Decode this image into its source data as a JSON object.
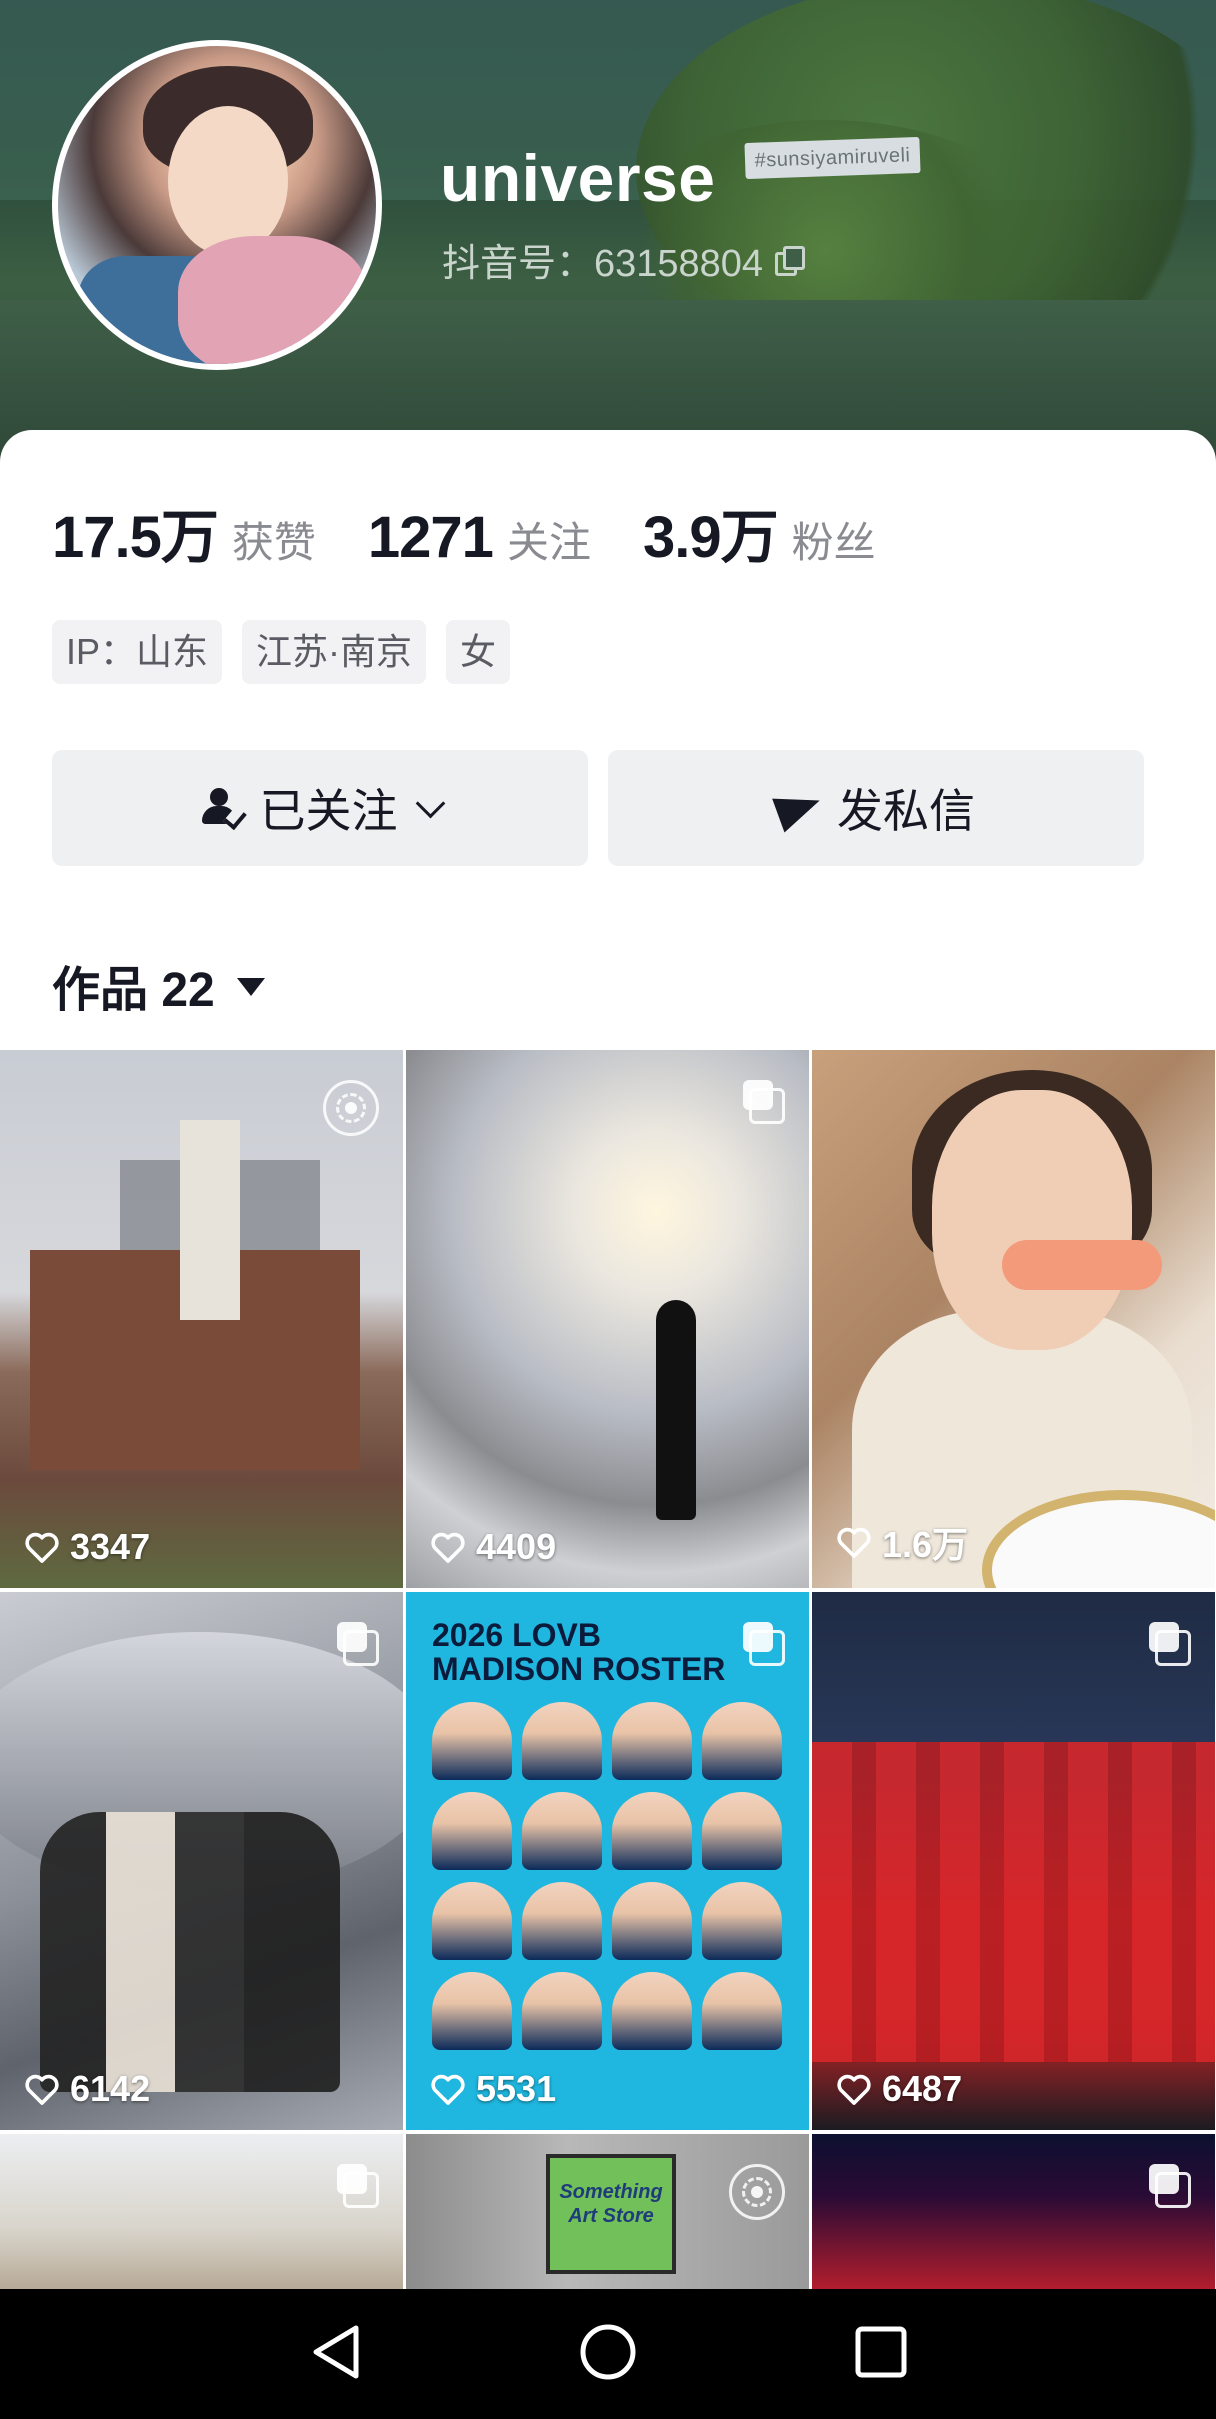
{
  "profile": {
    "username": "universe",
    "douyin_id": "抖音号：63158804",
    "cover_sign": "#sunsiyamiruveli"
  },
  "stats": [
    {
      "num": "17.5万",
      "label": "获赞"
    },
    {
      "num": "1271",
      "label": "关注"
    },
    {
      "num": "3.9万",
      "label": "粉丝"
    }
  ],
  "tags": [
    "IP：山东",
    "江苏·南京",
    "女"
  ],
  "buttons": {
    "follow": "已关注",
    "message": "发私信"
  },
  "works": {
    "label": "作品 22"
  },
  "tiles": [
    {
      "likes": "3347",
      "corner": "live-icon"
    },
    {
      "likes": "4409",
      "corner": "multi-icon"
    },
    {
      "likes": "1.6万",
      "corner": ""
    },
    {
      "likes": "6142",
      "corner": "multi-icon"
    },
    {
      "likes": "5531",
      "corner": "multi-icon"
    },
    {
      "likes": "6487",
      "corner": "multi-icon"
    },
    {
      "likes": "",
      "corner": "multi-icon"
    },
    {
      "likes": "",
      "corner": "live-icon"
    },
    {
      "likes": "",
      "corner": "multi-icon"
    }
  ],
  "roster": {
    "title_line1": "2026 LOVB",
    "title_line2": "MADISON ROSTER"
  },
  "tile8_sign": "Something Art Store",
  "colors": {
    "accent": "#161823",
    "muted": "#8a8b91"
  }
}
